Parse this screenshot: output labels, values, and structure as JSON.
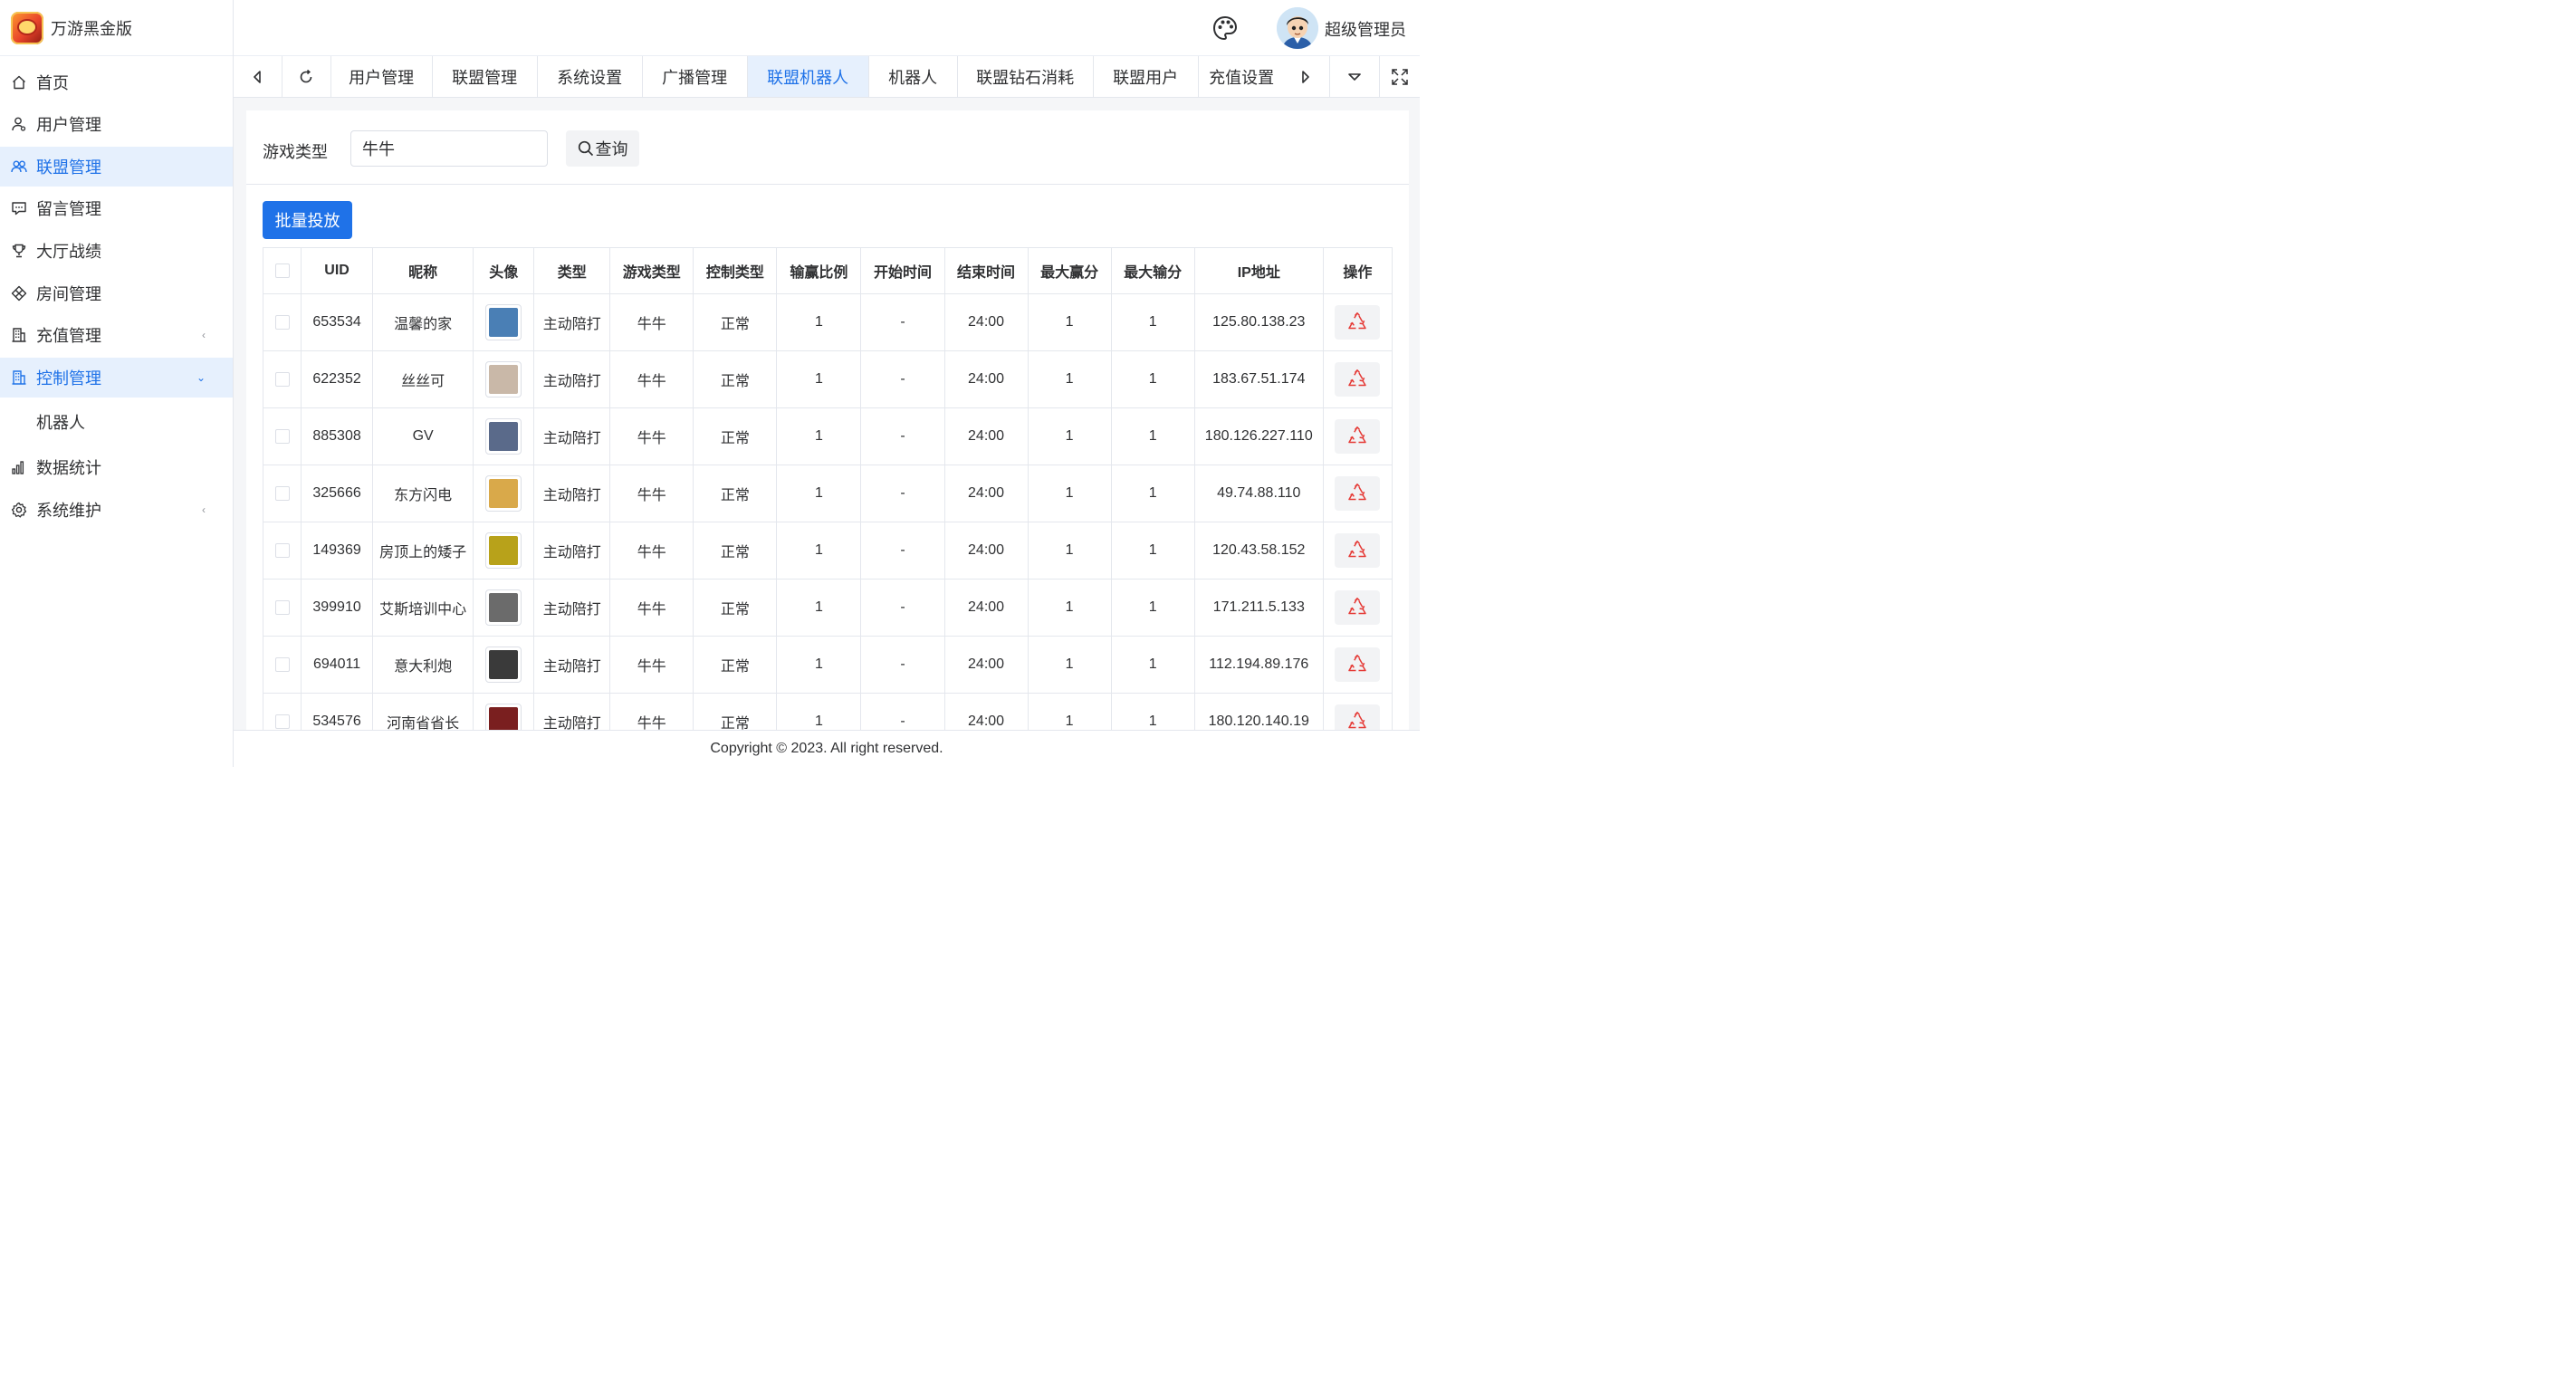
{
  "app": {
    "title": "万游黑金版"
  },
  "header": {
    "user_name": "超级管理员",
    "icons": [
      "palette-icon",
      "avatar"
    ]
  },
  "sidebar": {
    "items": [
      {
        "label": "首页",
        "icon": "home-icon",
        "active": false
      },
      {
        "label": "用户管理",
        "icon": "user-icon",
        "active": false
      },
      {
        "label": "联盟管理",
        "icon": "users-icon",
        "active": true
      },
      {
        "label": "留言管理",
        "icon": "message-icon",
        "active": false
      },
      {
        "label": "大厅战绩",
        "icon": "trophy-icon",
        "active": false
      },
      {
        "label": "房间管理",
        "icon": "diamond-icon",
        "active": false
      },
      {
        "label": "充值管理",
        "icon": "building-icon",
        "active": false,
        "arrow": "‹"
      },
      {
        "label": "控制管理",
        "icon": "building-icon",
        "active": true,
        "arrow": "⌄"
      },
      {
        "label": "数据统计",
        "icon": "chart-icon",
        "active": false
      },
      {
        "label": "系统维护",
        "icon": "gear-icon",
        "active": false,
        "arrow": "‹"
      }
    ],
    "submenu": {
      "label": "机器人"
    }
  },
  "tabs": {
    "items": [
      "用户管理",
      "联盟管理",
      "系统设置",
      "广播管理",
      "联盟机器人",
      "机器人",
      "联盟钻石消耗",
      "联盟用户",
      "充值设置"
    ],
    "active_index": 4
  },
  "filter": {
    "label": "游戏类型",
    "value": "牛牛",
    "query_label": "查询"
  },
  "batch_button": {
    "label": "批量投放"
  },
  "table": {
    "headers": [
      "UID",
      "昵称",
      "头像",
      "类型",
      "游戏类型",
      "控制类型",
      "输赢比例",
      "开始时间",
      "结束时间",
      "最大赢分",
      "最大输分",
      "IP地址",
      "操作"
    ],
    "rows": [
      {
        "uid": "653534",
        "nickname": "温馨的家",
        "type": "主动陪打",
        "game": "牛牛",
        "control": "正常",
        "ratio": "1",
        "start": "-",
        "end": "24:00",
        "max_win": "1",
        "max_lose": "1",
        "ip": "125.80.138.23",
        "avatar_color": "#4a7fb5"
      },
      {
        "uid": "622352",
        "nickname": "丝丝可",
        "type": "主动陪打",
        "game": "牛牛",
        "control": "正常",
        "ratio": "1",
        "start": "-",
        "end": "24:00",
        "max_win": "1",
        "max_lose": "1",
        "ip": "183.67.51.174",
        "avatar_color": "#c9b8a8"
      },
      {
        "uid": "885308",
        "nickname": "GV",
        "type": "主动陪打",
        "game": "牛牛",
        "control": "正常",
        "ratio": "1",
        "start": "-",
        "end": "24:00",
        "max_win": "1",
        "max_lose": "1",
        "ip": "180.126.227.110",
        "avatar_color": "#5a6a8a"
      },
      {
        "uid": "325666",
        "nickname": "东方闪电",
        "type": "主动陪打",
        "game": "牛牛",
        "control": "正常",
        "ratio": "1",
        "start": "-",
        "end": "24:00",
        "max_win": "1",
        "max_lose": "1",
        "ip": "49.74.88.110",
        "avatar_color": "#d9a94a"
      },
      {
        "uid": "149369",
        "nickname": "房顶上的矮子",
        "type": "主动陪打",
        "game": "牛牛",
        "control": "正常",
        "ratio": "1",
        "start": "-",
        "end": "24:00",
        "max_win": "1",
        "max_lose": "1",
        "ip": "120.43.58.152",
        "avatar_color": "#b8a21a"
      },
      {
        "uid": "399910",
        "nickname": "艾斯培训中心",
        "type": "主动陪打",
        "game": "牛牛",
        "control": "正常",
        "ratio": "1",
        "start": "-",
        "end": "24:00",
        "max_win": "1",
        "max_lose": "1",
        "ip": "171.211.5.133",
        "avatar_color": "#6b6b6b"
      },
      {
        "uid": "694011",
        "nickname": "意大利炮",
        "type": "主动陪打",
        "game": "牛牛",
        "control": "正常",
        "ratio": "1",
        "start": "-",
        "end": "24:00",
        "max_win": "1",
        "max_lose": "1",
        "ip": "112.194.89.176",
        "avatar_color": "#3a3a3a"
      },
      {
        "uid": "534576",
        "nickname": "河南省省长",
        "type": "主动陪打",
        "game": "牛牛",
        "control": "正常",
        "ratio": "1",
        "start": "-",
        "end": "24:00",
        "max_win": "1",
        "max_lose": "1",
        "ip": "180.120.140.19",
        "avatar_color": "#7a1f1f"
      }
    ]
  },
  "footer": {
    "text": "Copyright © 2023. All right reserved."
  },
  "colors": {
    "primary": "#1f72e8",
    "active_bg": "#e6f0fd",
    "delete_icon": "#e53935"
  }
}
